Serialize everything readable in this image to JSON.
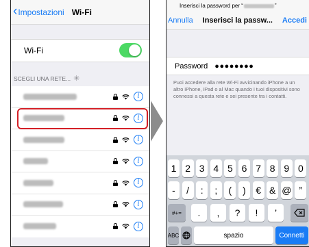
{
  "left": {
    "nav": {
      "back_label": "Impostazioni",
      "title": "Wi-Fi"
    },
    "wifi_row": {
      "label": "Wi-Fi",
      "toggle_on": true
    },
    "section_header": "SCEGLI UNA RETE...",
    "networks": [
      {
        "highlighted": false
      },
      {
        "highlighted": true
      },
      {
        "highlighted": false
      },
      {
        "highlighted": false
      },
      {
        "highlighted": false
      },
      {
        "highlighted": false
      },
      {
        "highlighted": false
      }
    ],
    "info_glyph": "i",
    "icons": [
      "chevron-left-icon",
      "spinner-icon",
      "lock-icon",
      "wifi-icon",
      "info-icon"
    ]
  },
  "right": {
    "prompt": {
      "prefix": "Inserisci la password per “",
      "suffix": "”"
    },
    "nav": {
      "cancel_label": "Annulla",
      "title": "Inserisci la passw...",
      "join_label": "Accedi"
    },
    "password": {
      "label": "Password",
      "masked_value": "●●●●●●●●"
    },
    "help_text": "Puoi accedere alla rete Wi-Fi avvicinando iPhone a un altro iPhone, iPad o al Mac quando i tuoi dispositivi sono connessi a questa rete e sei presente tra i contatti.",
    "keyboard": {
      "row1": [
        "1",
        "2",
        "3",
        "4",
        "5",
        "6",
        "7",
        "8",
        "9",
        "0"
      ],
      "row2": [
        "-",
        "/",
        ":",
        ";",
        "(",
        ")",
        "€",
        "&",
        "@",
        "”"
      ],
      "row3_left": "#+=",
      "row3": [
        ".",
        ",",
        "?",
        "!",
        "’"
      ],
      "row4": {
        "abc": "ABC",
        "space": "spazio",
        "connect": "Connetti"
      },
      "icons": [
        "backspace-icon",
        "globe-icon"
      ]
    }
  },
  "colors": {
    "accent": "#1a7cf5",
    "toggle": "#4cd964",
    "highlight": "#d42027",
    "arrow": "#8c8c8c"
  }
}
